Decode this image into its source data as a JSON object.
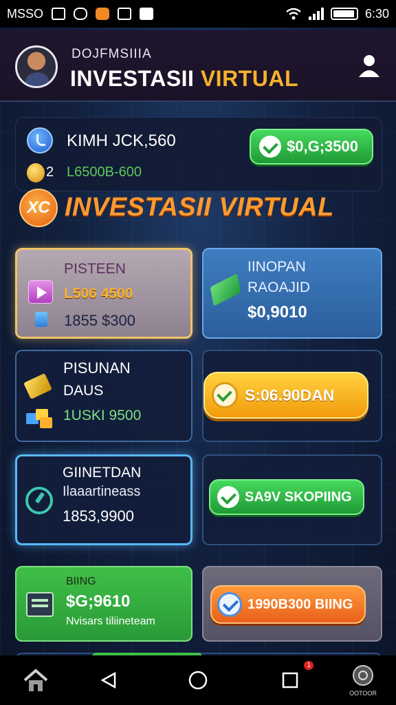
{
  "status_bar": {
    "carrier": "MSSO",
    "time": "6:30",
    "icons": [
      "image-icon",
      "gamepad-icon",
      "app-icon",
      "screen-icon",
      "check-icon",
      "wifi-icon",
      "signal-icon",
      "battery-icon"
    ]
  },
  "header": {
    "subtitle": "DOJFMSIIIA",
    "title_white": "INVESTASII",
    "title_yellow": "VIRTUAL",
    "colors": {
      "white": "#ffffff",
      "accent": "#f5b22b"
    }
  },
  "balance": {
    "line1": "KIMH JCK,560",
    "count": "2",
    "line2": "L6500B-600",
    "button_label": "$0,G;3500"
  },
  "section": {
    "badge": "XC",
    "title": "INVESTASII VIRTUAL"
  },
  "cards": {
    "c1": {
      "label": "PISTEEN",
      "value1": "L506 4500",
      "value2": "1855 $300"
    },
    "c2": {
      "line1": "IINOPAN",
      "line2": "RAOAJID",
      "value": "$0,9010"
    },
    "c3": {
      "line1": "PISUNAN",
      "line2": "DAUS",
      "value": "1USKI 9500"
    },
    "c4": {
      "button_label": "S:06.90DAN"
    },
    "c5": {
      "line1": "GIINETDAN",
      "line2": "Ilaaartineass",
      "value": "1853,9900"
    },
    "c6": {
      "button_label": "SA9V SKOPIING"
    },
    "c7": {
      "label": "BIING",
      "value": "$G;9610",
      "line2": "Nvisars tiliineteam"
    },
    "c8": {
      "button_label": "1990B300 BIING"
    }
  },
  "nav": {
    "items": [
      "home-icon",
      "back-icon",
      "home-circle-icon",
      "recents-icon",
      "account-icon"
    ],
    "recents_badge": "1",
    "account_label": "OOTOOR"
  }
}
